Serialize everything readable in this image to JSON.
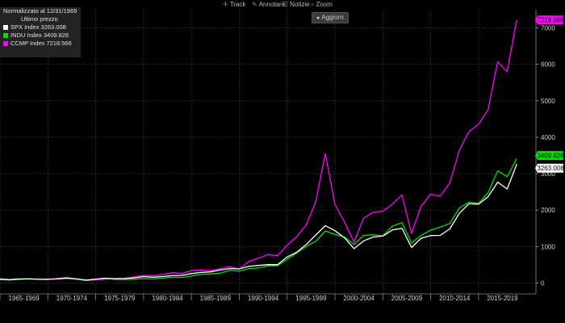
{
  "toolbar": {
    "items": [
      {
        "icon": "crosshair-icon",
        "glyph": "✛",
        "label": "Track"
      },
      {
        "icon": "pencil-icon",
        "glyph": "✎",
        "label": "Annotare"
      },
      {
        "icon": "news-icon",
        "glyph": "☰",
        "label": "Notizie"
      },
      {
        "icon": "zoom-icon",
        "glyph": "⌕",
        "label": "Zoom"
      }
    ],
    "refresh_label": "Aggiorn"
  },
  "legend": {
    "header": "Normalizzato al 12/31/1969",
    "subheader": "Ultimo prezzo"
  },
  "chart_data": {
    "type": "line",
    "x_unit": "year",
    "x_range": [
      1965,
      2021
    ],
    "ylim": [
      -300,
      7500
    ],
    "y_ticks": [
      0,
      1000,
      2000,
      3000,
      4000,
      5000,
      6000,
      7000
    ],
    "x_tick_labels": [
      "1965-1969",
      "1970-1974",
      "1975-1979",
      "1980-1984",
      "1985-1989",
      "1990-1994",
      "1995-1999",
      "2000-2004",
      "2005-2009",
      "2010-2014",
      "2015-2019"
    ],
    "grid": true,
    "legend_position": "top-left",
    "series": [
      {
        "name": "SPX Index",
        "last_label": "3263.008",
        "color": "#ffffff",
        "x": [
          1965,
          1966,
          1967,
          1968,
          1969,
          1970,
          1971,
          1972,
          1973,
          1974,
          1975,
          1976,
          1977,
          1978,
          1979,
          1980,
          1981,
          1982,
          1983,
          1984,
          1985,
          1986,
          1987,
          1988,
          1989,
          1990,
          1991,
          1992,
          1993,
          1994,
          1995,
          1996,
          1997,
          1998,
          1999,
          2000,
          2001,
          2002,
          2003,
          2004,
          2005,
          2006,
          2007,
          2008,
          2009,
          2010,
          2011,
          2012,
          2013,
          2014,
          2015,
          2016,
          2017,
          2018,
          2019
        ],
        "values": [
          98,
          86,
          103,
          113,
          100,
          101,
          114,
          134,
          113,
          80,
          106,
          129,
          117,
          120,
          140,
          174,
          158,
          176,
          201,
          207,
          258,
          290,
          305,
          355,
          396,
          387,
          455,
          483,
          505,
          502,
          713,
          846,
          1058,
          1318,
          1575,
          1434,
          1241,
          943,
          1156,
          1263,
          1286,
          1454,
          1504,
          975,
          1227,
          1302,
          1307,
          1483,
          1914,
          2176,
          2162,
          2365,
          2766,
          2581,
          3263
        ]
      },
      {
        "name": "INDU Index",
        "last_label": "3409.826",
        "color": "#00e000",
        "x": [
          1965,
          1966,
          1967,
          1968,
          1969,
          1970,
          1971,
          1972,
          1973,
          1974,
          1975,
          1976,
          1977,
          1978,
          1979,
          1980,
          1981,
          1982,
          1983,
          1984,
          1985,
          1986,
          1987,
          1988,
          1989,
          1990,
          1991,
          1992,
          1993,
          1994,
          1995,
          1996,
          1997,
          1998,
          1999,
          2000,
          2001,
          2002,
          2003,
          2004,
          2005,
          2006,
          2007,
          2008,
          2009,
          2010,
          2011,
          2012,
          2013,
          2014,
          2015,
          2016,
          2017,
          2018,
          2019
        ],
        "values": [
          121,
          99,
          114,
          118,
          100,
          105,
          111,
          128,
          105,
          79,
          108,
          125,
          103,
          96,
          105,
          119,
          109,
          134,
          156,
          151,
          190,
          240,
          247,
          270,
          344,
          328,
          393,
          411,
          471,
          481,
          650,
          821,
          1006,
          1145,
          1428,
          1330,
          1261,
          1059,
          1306,
          1322,
          1293,
          1560,
          1657,
          1097,
          1305,
          1450,
          1538,
          1633,
          2059,
          2217,
          2185,
          2477,
          3077,
          2917,
          3410
        ]
      },
      {
        "name": "CCMP Index",
        "last_label": "7218.566",
        "color": "#ff00ff",
        "x": [
          1965,
          1966,
          1967,
          1968,
          1969,
          1970,
          1971,
          1972,
          1973,
          1974,
          1975,
          1976,
          1977,
          1978,
          1979,
          1980,
          1981,
          1982,
          1983,
          1984,
          1985,
          1986,
          1987,
          1988,
          1989,
          1990,
          1991,
          1992,
          1993,
          1994,
          1995,
          1996,
          1997,
          1998,
          1999,
          2000,
          2001,
          2002,
          2003,
          2004,
          2005,
          2006,
          2007,
          2008,
          2009,
          2010,
          2011,
          2012,
          2013,
          2014,
          2015,
          2016,
          2017,
          2018,
          2019
        ],
        "values": [
          95,
          85,
          110,
          120,
          100,
          95,
          125,
          150,
          105,
          65,
          85,
          110,
          120,
          130,
          160,
          210,
          200,
          235,
          285,
          260,
          340,
          360,
          340,
          390,
          450,
          380,
          590,
          680,
          780,
          750,
          1030,
          1270,
          1590,
          2230,
          3550,
          2160,
          1670,
          1120,
          1780,
          1940,
          1970,
          2160,
          2420,
          1360,
          2100,
          2440,
          2380,
          2740,
          3640,
          4150,
          4360,
          4750,
          6070,
          5800,
          7218
        ]
      }
    ]
  }
}
